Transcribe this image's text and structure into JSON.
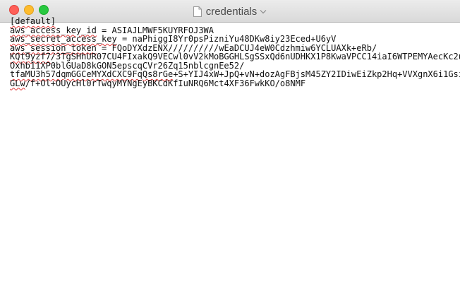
{
  "window": {
    "title": "credentials"
  },
  "editor": {
    "lines": [
      {
        "pre": "",
        "sq": "[default]",
        "post": ""
      },
      {
        "pre": "",
        "sq": "aws_access_key_id",
        "post": " = ASIAJLMWF5KUYRFOJ3WA"
      },
      {
        "pre": "",
        "sq": "aws_secret_access_key",
        "post": " = naPhiggI8Yr0psPizniYu48DKw8iy23Eced+U6yV"
      },
      {
        "pre": "",
        "sq": "aws_session_token",
        "post": " = FQoDYXdzENX//////////wEaDCUJ4eW0Cdzhmiw6YCLUAXk+eRb/"
      },
      {
        "pre": "",
        "sq": "KQt9yzf7",
        "post": "/3TgSHhUR07CU4FIxakQ9VECwl0vV2kMoBGGHLSgSSxQd6nUDHKX1P8KwaVPCC14iaI6WTPEMYAecKc2uG"
      },
      {
        "pre": "",
        "sq": "",
        "post": "Oxhb11XP0blGUaD8kGON5epscqCVr26Zq15nblcgnEe52/"
      },
      {
        "pre": "",
        "sq": "tfaMU3h57dqmGGCeMYXdCXC9FqQs8rGe",
        "post": "+S+YIJ4xW+JpQ+vN+dozAgFBjsM45ZY2IDiwEiZkp2Hq+VVXgnX6i1Gsi"
      },
      {
        "pre": "",
        "sq": "GLw",
        "post": "/f+Ol+OUycHl0rTwqyMYNgEyBKCdKfIuNRQ6Mct4XF36FwkKO/o8NMF"
      }
    ]
  }
}
